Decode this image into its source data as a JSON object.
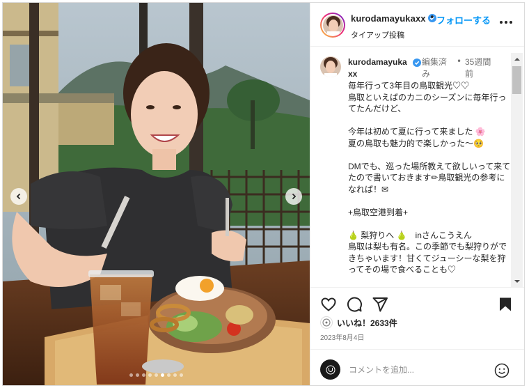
{
  "post": {
    "username": "kurodamayukaxx",
    "follow_separator": "•",
    "follow_label": "フォローする",
    "subtitle": "タイアップ投稿",
    "more_icon": "more-horizontal-icon"
  },
  "caption": {
    "username": "kurodamayukaxx",
    "edited": "編集済み",
    "separator": "•",
    "age": "35週間前",
    "text": "毎年行って3年目の鳥取観光♡♡\n鳥取といえばのカニのシーズンに毎年行ってたんだけど、\n\n今年は初めて夏に行って来ました 🌸\n夏の鳥取も魅力的で楽しかった〜🥺\n\nDMでも、巡った場所教えて欲しいって来てたので書いておきます✏鳥取観光の参考になれば！✉\n\n+鳥取空港到着+\n\n🍐 梨狩りへ 🍐　inさんこうえん\n鳥取は梨も有名。この季節でも梨狩りができちゃいます！甘くてジューシーな梨を狩ってその場で食べることも♡"
  },
  "actions": {
    "like_icon": "heart-icon",
    "comment_icon": "comment-icon",
    "share_icon": "share-icon",
    "save_icon": "bookmark-icon"
  },
  "likes": {
    "text": "いいね！2633件"
  },
  "date": "2023年8月4日",
  "comment_box": {
    "placeholder": "コメントを追加...",
    "emoji_icon": "smiley-icon"
  },
  "carousel": {
    "total_slides": 9,
    "active_slide": 6
  },
  "colors": {
    "follow_blue": "#0095f6",
    "verified_blue": "#3897f0",
    "text_primary": "#262626",
    "text_secondary": "#737373"
  }
}
